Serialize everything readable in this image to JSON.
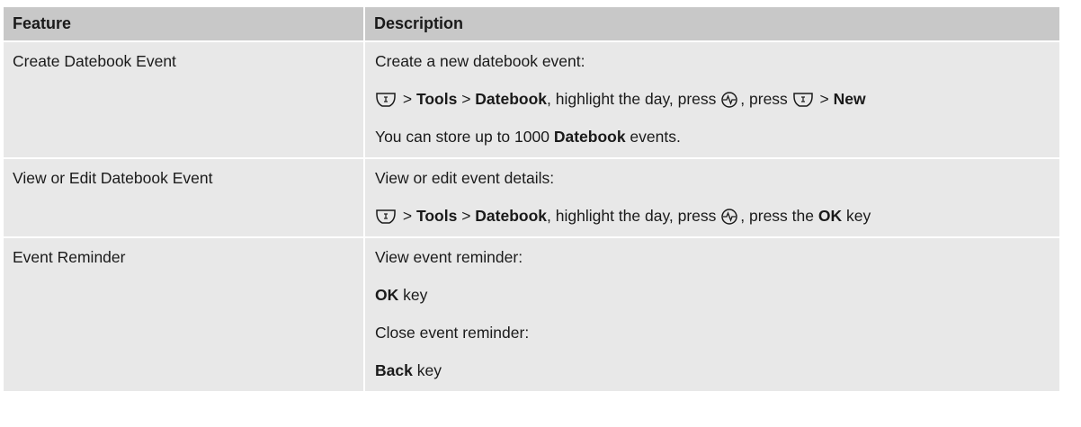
{
  "table": {
    "headers": {
      "feature": "Feature",
      "description": "Description"
    },
    "rows": [
      {
        "feature": "Create Datebook Event",
        "lines": {
          "l1": "Create a new datebook event:",
          "l2": {
            "s1": " > ",
            "s2": "Tools",
            "s3": " > ",
            "s4": "Datebook",
            "s5": ", highlight the day, press ",
            "s6": ", press ",
            "s7": " > ",
            "s8": "New"
          },
          "l3": {
            "s1": "You can store up to 1000 ",
            "s2": "Datebook",
            "s3": " events."
          }
        }
      },
      {
        "feature": "View or Edit Datebook Event",
        "lines": {
          "l1": "View or edit event details:",
          "l2": {
            "s1": " > ",
            "s2": "Tools",
            "s3": " > ",
            "s4": "Datebook",
            "s5": ", highlight the day, press ",
            "s6": ", press the ",
            "s7": "OK",
            "s8": " key"
          }
        }
      },
      {
        "feature": "Event Reminder",
        "lines": {
          "l1": "View event reminder:",
          "l2": {
            "s1": "OK",
            "s2": " key"
          },
          "l3": "Close event reminder:",
          "l4": {
            "s1": "Back",
            "s2": " key"
          }
        }
      }
    ]
  },
  "icons": {
    "menu_key": "menu-key-icon",
    "nav_key": "nav-key-icon"
  }
}
